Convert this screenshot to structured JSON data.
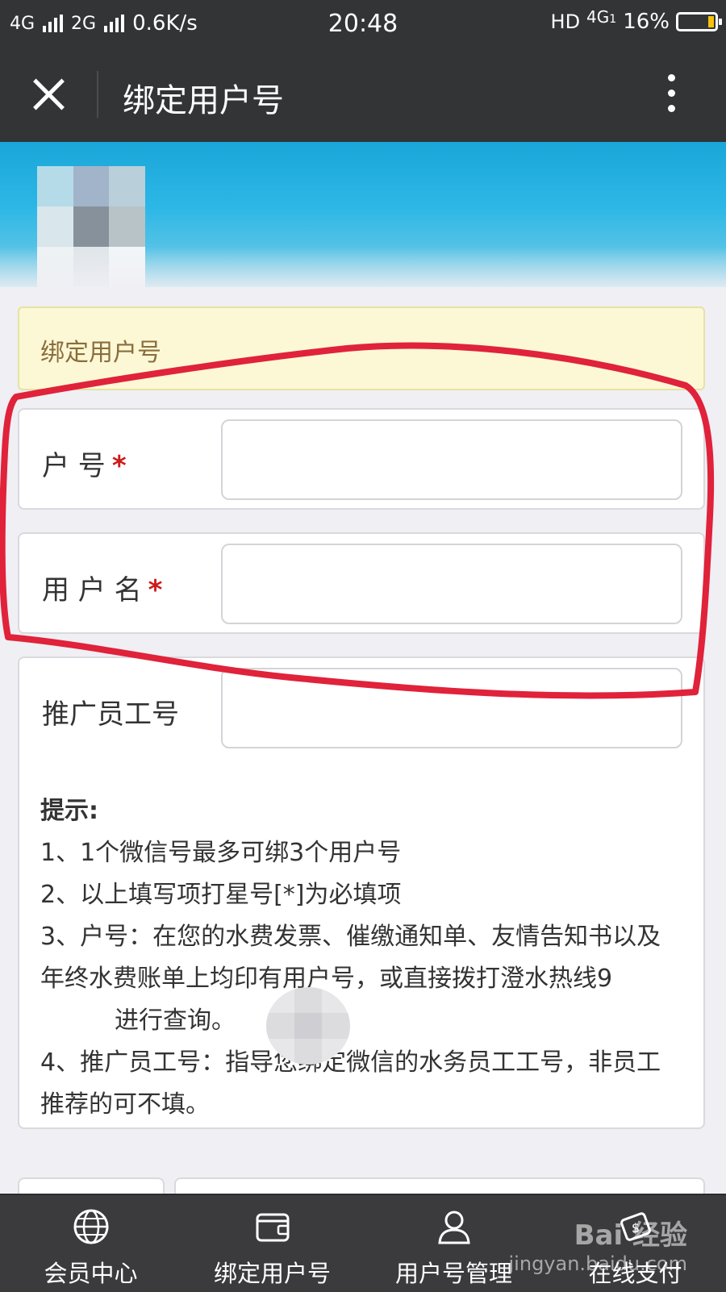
{
  "status_bar": {
    "network_1": "4G",
    "network_2": "2G",
    "speed": "0.6K/s",
    "time": "20:48",
    "hd": "HD",
    "net_right": "4G",
    "net_right_sub": "1",
    "battery": "16%",
    "battery_level": 0.16
  },
  "header": {
    "title": "绑定用户号"
  },
  "notice": {
    "text": "绑定用户号"
  },
  "form": {
    "account": {
      "label": "户 号",
      "required_mark": "*",
      "value": ""
    },
    "username": {
      "label": "用 户 名",
      "required_mark": "*",
      "value": ""
    },
    "promoter": {
      "label": "推广员工号",
      "value": ""
    }
  },
  "tips": {
    "title": "提示:",
    "lines": [
      "1、1个微信号最多可绑3个用户号",
      "2、以上填写项打星号[*]为必填项",
      "3、户号：在您的水费发票、催缴通知单、友情告知书以及年终水费账单上均印有用户号，或直接拨打澄水热线9",
      "进行查询。",
      "4、推广员工号：指导您绑定微信的水务员工工号，非员工推荐的可不填。"
    ]
  },
  "tabbar": {
    "items": [
      {
        "label": "会员中心",
        "icon": "globe-icon"
      },
      {
        "label": "绑定用户号",
        "icon": "wallet-icon"
      },
      {
        "label": "用户号管理",
        "icon": "user-icon"
      },
      {
        "label": "在线支付",
        "icon": "payment-icon"
      }
    ]
  },
  "watermark": {
    "brand": "Bai 经验",
    "url": "jingyan.baidu.com"
  },
  "colors": {
    "header_bg": "#333436",
    "banner": "#1aa6d8",
    "notice_bg": "#fcf8d6",
    "notice_text": "#8a6d3b",
    "required": "#cc1a1a",
    "annotation": "#e0223a",
    "tabbar_bg": "#3b3b3d"
  }
}
